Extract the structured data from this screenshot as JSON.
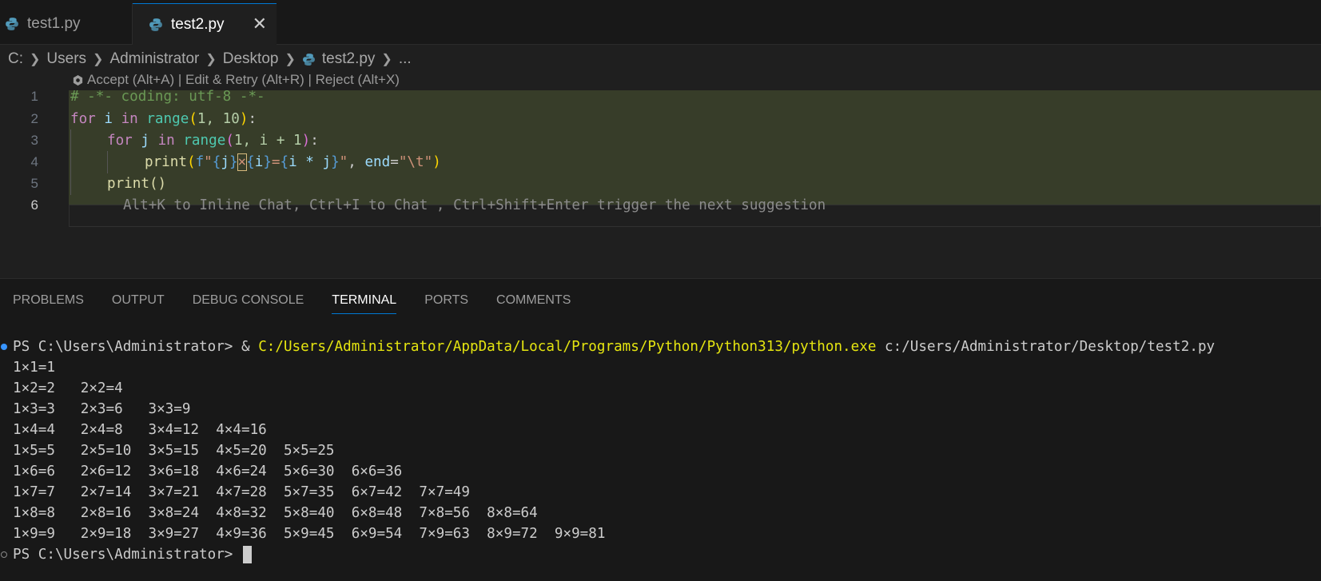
{
  "tabs": [
    {
      "label": "test1.py",
      "active": false
    },
    {
      "label": "test2.py",
      "active": true
    }
  ],
  "close_glyph": "✕",
  "breadcrumb": [
    "C:",
    "Users",
    "Administrator",
    "Desktop",
    "test2.py",
    "..."
  ],
  "codelens": "Accept (Alt+A) | Edit & Retry (Alt+R) | Reject (Alt+X)",
  "line_numbers": [
    "1",
    "2",
    "3",
    "4",
    "5",
    "6"
  ],
  "code": {
    "l1": "# -*- coding: utf-8 -*-",
    "l2_for": "for",
    "l2_i": "i",
    "l2_in": "in",
    "l2_range": "range",
    "l2_args": "1, 10",
    "l3_for": "for",
    "l3_j": "j",
    "l3_in": "in",
    "l3_range": "range",
    "l3_args1": "1, i + 1",
    "l4_print": "print",
    "l4_f": "f",
    "l4_q1": "\"",
    "l4_j": "j",
    "l4_x": "×",
    "l4_i": "i",
    "l4_eq": "=",
    "l4_expr": "i * j",
    "l4_q2": "\"",
    "l4_end": "end",
    "l4_tab": "\"\\t\"",
    "l5": "print()",
    "l6_hint": "Alt+K to Inline Chat, Ctrl+I to Chat , Ctrl+Shift+Enter trigger the next suggestion"
  },
  "panel_tabs": [
    "PROBLEMS",
    "OUTPUT",
    "DEBUG CONSOLE",
    "TERMINAL",
    "PORTS",
    "COMMENTS"
  ],
  "terminal": {
    "prompt": "PS C:\\Users\\Administrator> ",
    "amp": "& ",
    "python_path": "C:/Users/Administrator/AppData/Local/Programs/Python/Python313/python.exe",
    "script_path": " c:/Users/Administrator/Desktop/test2.py",
    "rows": [
      "1×1=1",
      "1×2=2   2×2=4",
      "1×3=3   2×3=6   3×3=9",
      "1×4=4   2×4=8   3×4=12  4×4=16",
      "1×5=5   2×5=10  3×5=15  4×5=20  5×5=25",
      "1×6=6   2×6=12  3×6=18  4×6=24  5×6=30  6×6=36",
      "1×7=7   2×7=14  3×7=21  4×7=28  5×7=35  6×7=42  7×7=49",
      "1×8=8   2×8=16  3×8=24  4×8=32  5×8=40  6×8=48  7×8=56  8×8=64",
      "1×9=9   2×9=18  3×9=27  4×9=36  5×9=45  6×9=54  7×9=63  8×9=72  9×9=81"
    ],
    "final_prompt": "PS C:\\Users\\Administrator> "
  }
}
